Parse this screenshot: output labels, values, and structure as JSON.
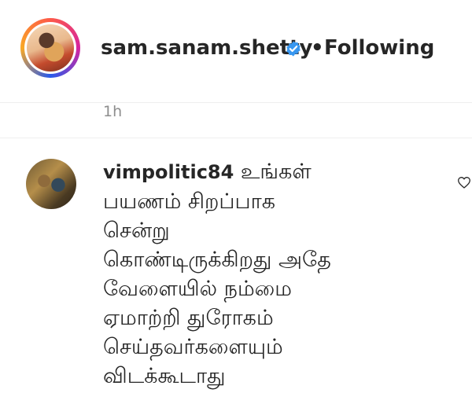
{
  "post": {
    "username": "sam.sanam.shetty",
    "separator": "•",
    "follow_status": "Following",
    "timestamp": "1h"
  },
  "comment": {
    "username": "vimpolitic84",
    "lines": [
      "உங்கள்",
      "பயணம் சிறப்பாக",
      "சென்று",
      "கொண்டிருக்கிறது அதே",
      "வேளையில் நம்மை",
      "ஏமாற்றி துரோகம்",
      "செய்தவர்களையும்",
      "விடக்கூடாது"
    ]
  },
  "icons": {
    "verified": "verified-badge-icon",
    "like": "heart-icon"
  },
  "colors": {
    "verified_blue": "#3897f0",
    "timestamp_gray": "#8e8e8e",
    "text": "#262626"
  }
}
